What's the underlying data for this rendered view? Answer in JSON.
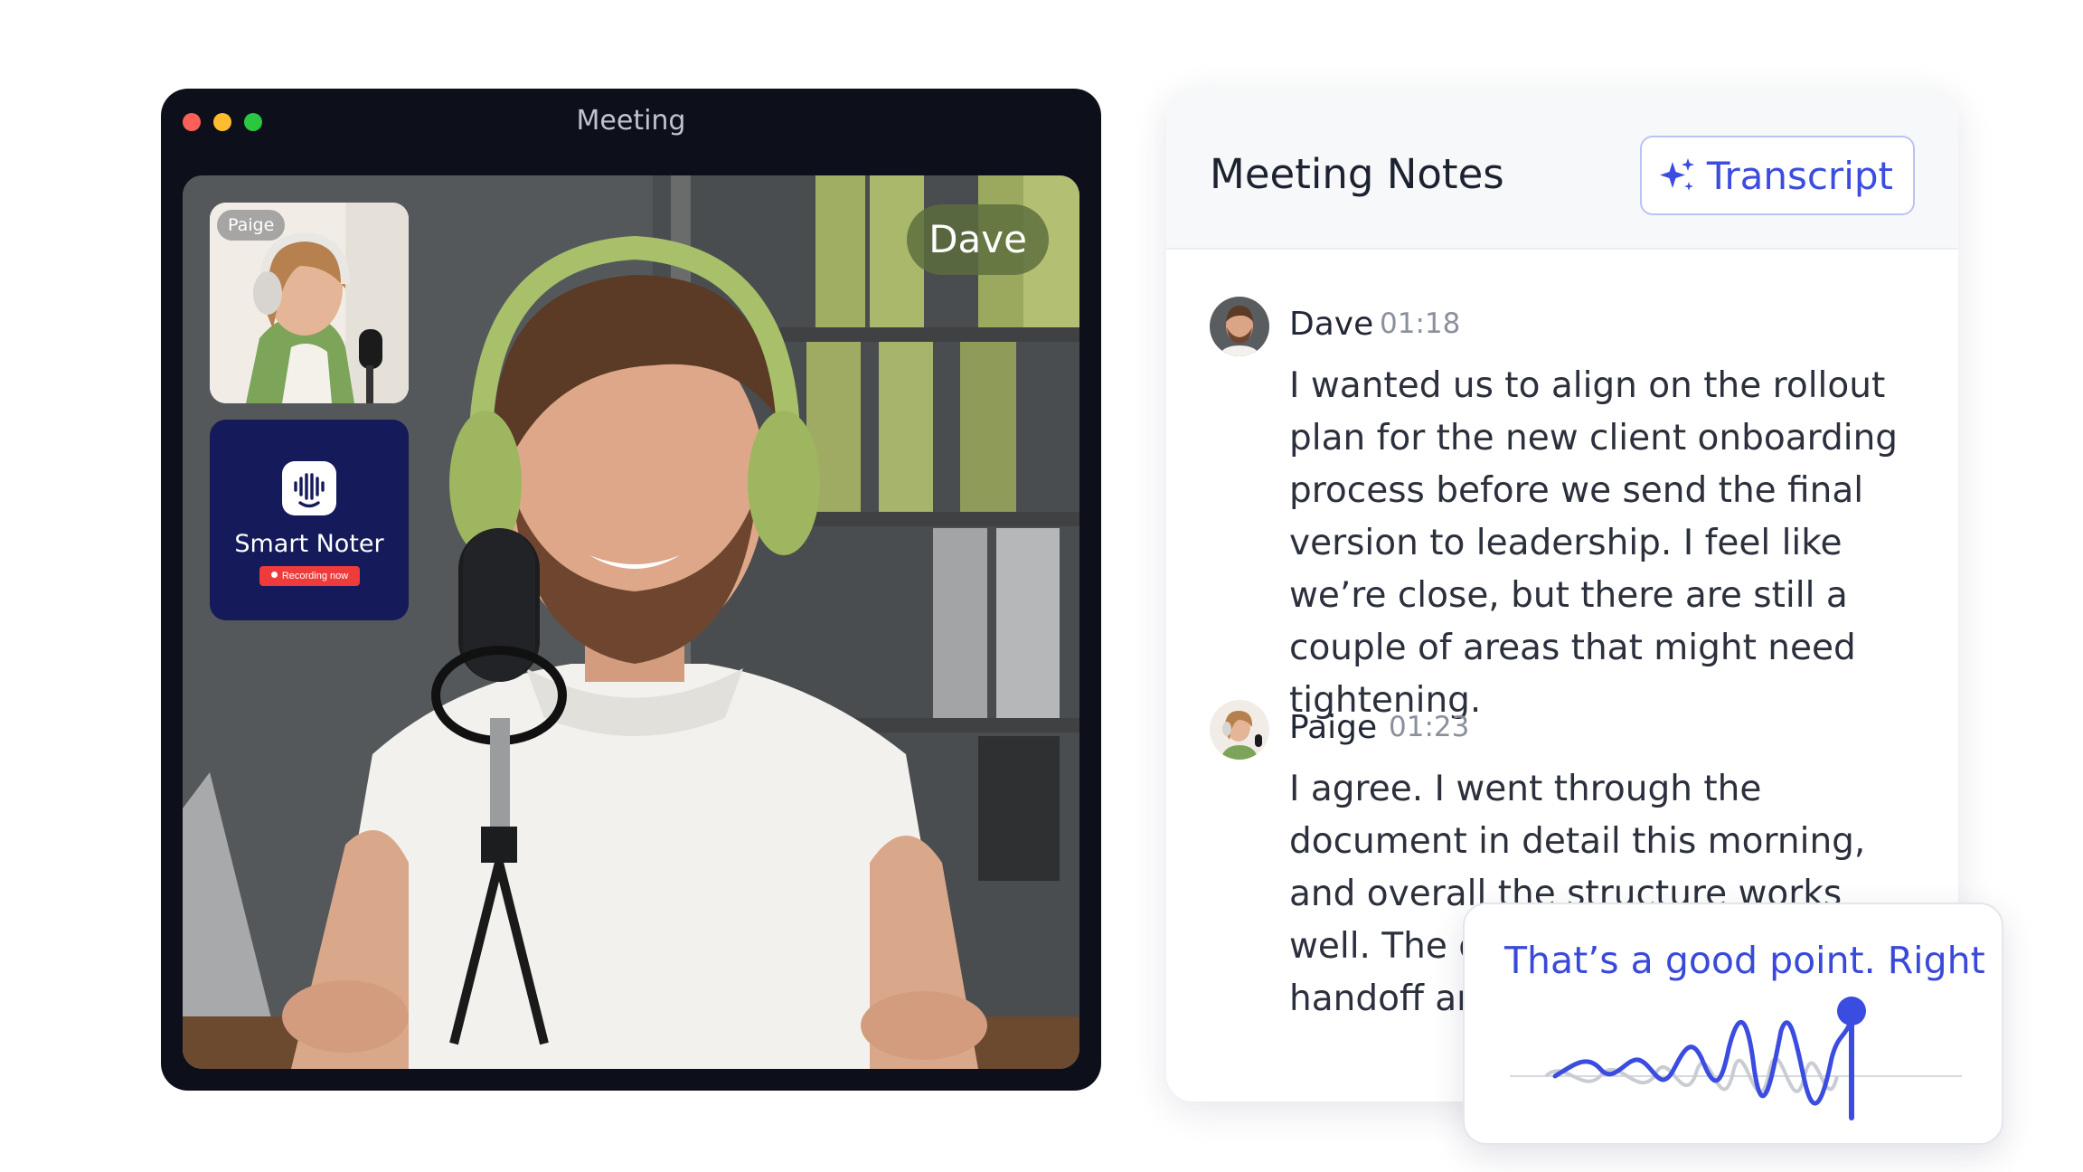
{
  "meeting_window": {
    "title": "Meeting",
    "speaker_label": "Dave",
    "participants": [
      {
        "name": "Paige"
      }
    ],
    "bot": {
      "name": "Smart Noter",
      "status": "Recording now",
      "icon": "waveform-smile-icon"
    }
  },
  "notes": {
    "title": "Meeting Notes",
    "transcript_button": "Transcript",
    "transcript_icon": "sparkle-icon",
    "entries": [
      {
        "speaker": "Dave",
        "time": "01:18",
        "text": "I wanted us to align on the rollout plan for the new client onboarding process before we send the final version to leadership. I feel like we’re close, but there are still a couple of areas that might need tightening."
      },
      {
        "speaker": "Paige",
        "time": "01:23",
        "text": "I agree. I went through the document in detail this morning, and overall the structure works well. The only part t the transit handoff ar phase. It m"
      }
    ]
  },
  "live_caption": {
    "text": "That’s a good point. Right"
  },
  "colors": {
    "accent": "#3b4ce0",
    "window_bg": "#0d101b",
    "bot_tile": "#141a5a",
    "recording": "#ef3b3b"
  }
}
